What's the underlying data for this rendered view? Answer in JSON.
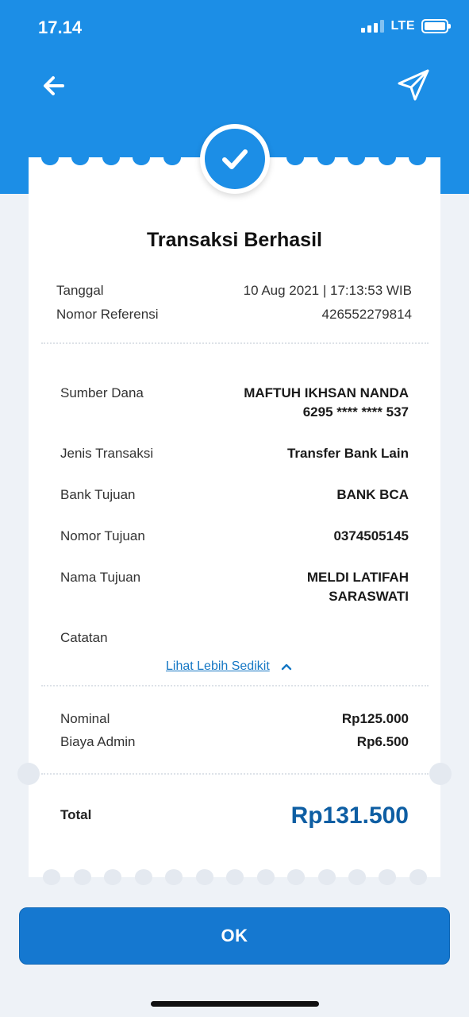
{
  "status_bar": {
    "time": "17.14",
    "network": "LTE"
  },
  "header": {
    "back_icon": "arrow-left-icon",
    "share_icon": "paper-plane-icon",
    "success_icon": "checkmark-icon"
  },
  "receipt": {
    "title": "Transaksi Berhasil",
    "meta": [
      {
        "label": "Tanggal",
        "value": "10 Aug 2021 | 17:13:53 WIB"
      },
      {
        "label": "Nomor Referensi",
        "value": "426552279814"
      }
    ],
    "details": {
      "sumber_dana_label": "Sumber Dana",
      "sumber_dana_name": "MAFTUH IKHSAN NANDA",
      "sumber_dana_account": "6295 **** **** 537",
      "jenis_label": "Jenis Transaksi",
      "jenis_value": "Transfer Bank Lain",
      "bank_label": "Bank Tujuan",
      "bank_value": "BANK BCA",
      "nomor_label": "Nomor Tujuan",
      "nomor_value": "0374505145",
      "nama_label": "Nama Tujuan",
      "nama_line1": "MELDI LATIFAH",
      "nama_line2": "SARASWATI",
      "catatan_label": "Catatan"
    },
    "toggle_label": "Lihat Lebih Sedikit",
    "amounts": [
      {
        "label": "Nominal",
        "value": "Rp125.000"
      },
      {
        "label": "Biaya Admin",
        "value": "Rp6.500"
      }
    ],
    "total_label": "Total",
    "total_value": "Rp131.500"
  },
  "ok_label": "OK",
  "colors": {
    "primary": "#1c8ee6",
    "button": "#1578d0",
    "total": "#0e5ea3",
    "link": "#1577c4"
  }
}
